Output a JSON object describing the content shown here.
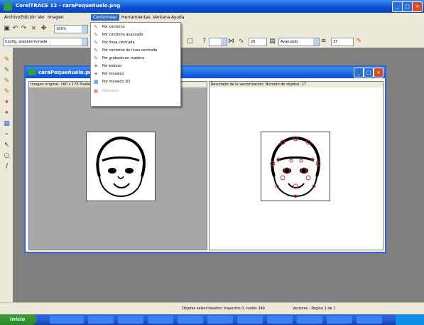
{
  "window": {
    "title": "CorelTRACE 12 - caraPequeñuelo.png"
  },
  "menubar": [
    "Archivo",
    "Edición",
    "Ver",
    "Imagen",
    "Contornear",
    "Herramientas",
    "Ventana",
    "Ayuda"
  ],
  "toolbar": {
    "zoom_value": "100%",
    "preset_value": "Config. predeterminada",
    "smoothing_value": "20",
    "mode_value": "Avanzado",
    "threshold_value": "37"
  },
  "contornear_menu": [
    {
      "label": "Por contorno",
      "icon": "trace-outline-icon",
      "enabled": true
    },
    {
      "label": "Por contorno avanzado",
      "icon": "trace-advanced-icon",
      "enabled": true
    },
    {
      "label": "Por línea centrada",
      "icon": "trace-centerline-icon",
      "enabled": true
    },
    {
      "label": "Por contorno de línea centrada",
      "icon": "trace-centerline-outline-icon",
      "enabled": true
    },
    {
      "label": "Por grabado en madera",
      "icon": "woodcut-icon",
      "enabled": true
    },
    {
      "label": "Por esbozo",
      "icon": "sketch-icon",
      "enabled": true
    },
    {
      "label": "Por mosaico",
      "icon": "mosaic-icon",
      "enabled": true
    },
    {
      "label": "Por mosaico 3D",
      "icon": "mosaic-3d-icon",
      "enabled": true
    },
    {
      "label": "Deshacer",
      "icon": "undo-icon",
      "enabled": false
    }
  ],
  "document": {
    "title": "caraPequeñuelo.png",
    "left_header": "Imagen original: 160 x 170 Píxeles",
    "right_header": "Resultado de la vectorización: Número de objetos: 17"
  },
  "statusbar": {
    "selection": "Objetos seleccionados: trayectos 0, nodos 349",
    "page": "Vectores : Página 1 de 1"
  },
  "taskbar": {
    "start_label": "Inicio"
  },
  "colors": {
    "xp_blue": "#0a4fcf",
    "trace_red": "#c33"
  }
}
